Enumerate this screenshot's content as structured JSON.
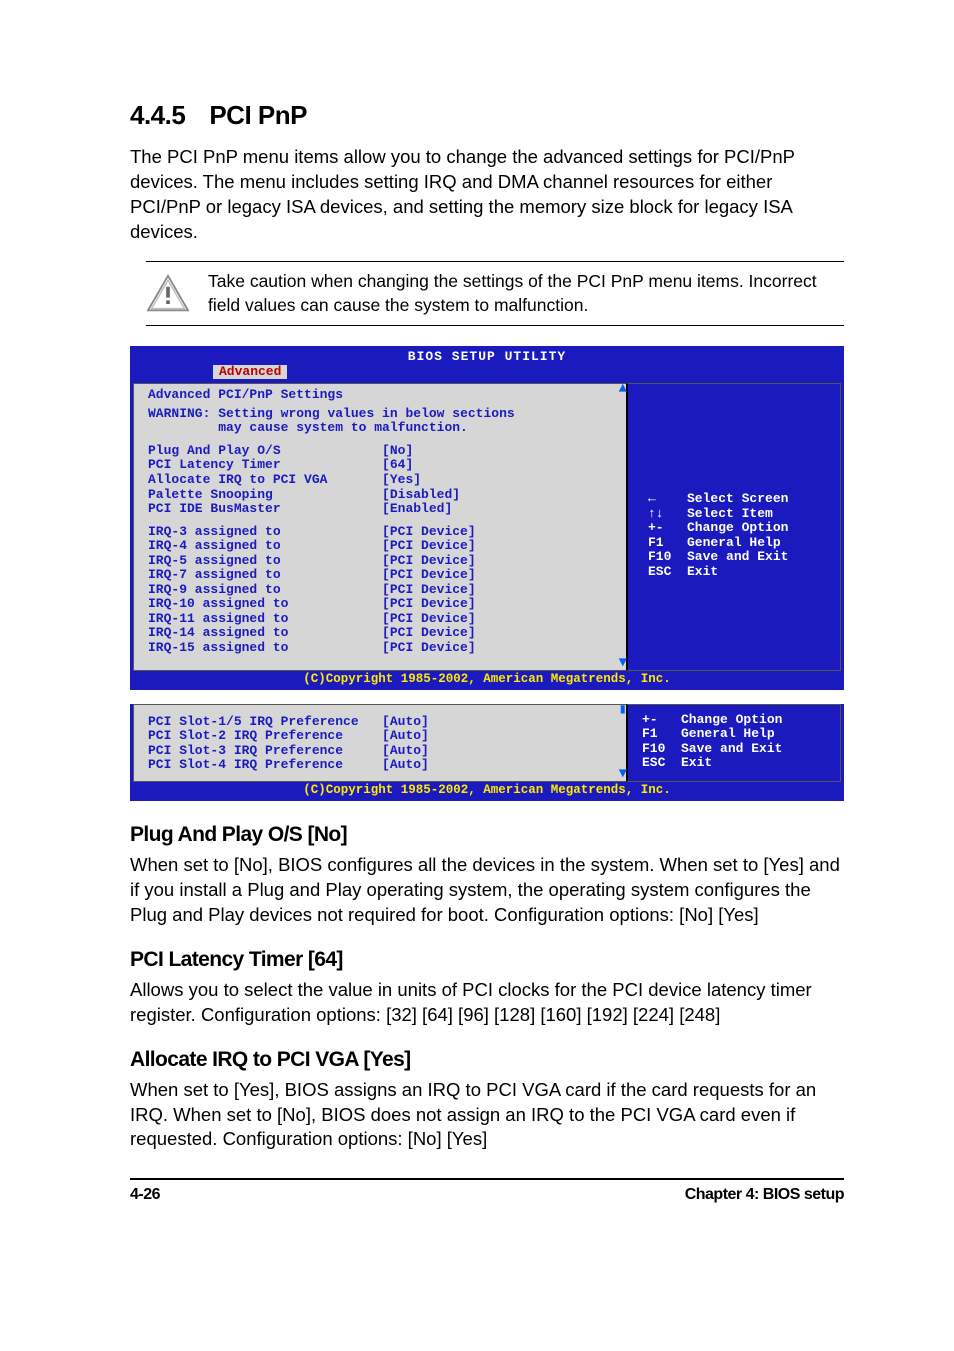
{
  "heading": {
    "num": "4.4.5",
    "title": "PCI PnP"
  },
  "intro": "The PCI PnP menu items allow you to change the advanced settings for PCI/PnP devices. The menu includes setting IRQ and DMA channel resources for either PCI/PnP or legacy ISA devices, and setting the memory size block for legacy ISA devices.",
  "caution": "Take caution when changing the settings of the PCI PnP menu items. Incorrect field values can cause the system to malfunction.",
  "bios1": {
    "title": "BIOS SETUP UTILITY",
    "tab": "Advanced",
    "subtitle": "Advanced PCI/PnP Settings",
    "warning_label": "WARNING:",
    "warning_text": "Setting wrong values in below sections\n         may cause system to malfunction.",
    "group1": [
      {
        "k": "Plug And Play O/S",
        "v": "[No]"
      },
      {
        "k": "PCI Latency Timer",
        "v": "[64]"
      },
      {
        "k": "Allocate IRQ to PCI VGA",
        "v": "[Yes]"
      },
      {
        "k": "Palette Snooping",
        "v": "[Disabled]"
      },
      {
        "k": "PCI IDE BusMaster",
        "v": "[Enabled]"
      }
    ],
    "group2": [
      {
        "k": "IRQ-3 assigned to",
        "v": "[PCI Device]"
      },
      {
        "k": "IRQ-4 assigned to",
        "v": "[PCI Device]"
      },
      {
        "k": "IRQ-5 assigned to",
        "v": "[PCI Device]"
      },
      {
        "k": "IRQ-7 assigned to",
        "v": "[PCI Device]"
      },
      {
        "k": "IRQ-9 assigned to",
        "v": "[PCI Device]"
      },
      {
        "k": "IRQ-10 assigned to",
        "v": "[PCI Device]"
      },
      {
        "k": "IRQ-11 assigned to",
        "v": "[PCI Device]"
      },
      {
        "k": "IRQ-14 assigned to",
        "v": "[PCI Device]"
      },
      {
        "k": "IRQ-15 assigned to",
        "v": "[PCI Device]"
      }
    ],
    "nav": [
      {
        "k": "←",
        "v": "Select Screen"
      },
      {
        "k": "↑↓",
        "v": "Select Item"
      },
      {
        "k": "+-",
        "v": "Change Option"
      },
      {
        "k": "F1",
        "v": "General Help"
      },
      {
        "k": "F10",
        "v": "Save and Exit"
      },
      {
        "k": "ESC",
        "v": "Exit"
      }
    ],
    "copyright": "(C)Copyright 1985-2002, American Megatrends, Inc."
  },
  "bios2": {
    "rows": [
      {
        "k": "PCI Slot-1/5 IRQ Preference",
        "v": "[Auto]"
      },
      {
        "k": "PCI Slot-2 IRQ Preference",
        "v": "[Auto]"
      },
      {
        "k": "PCI Slot-3 IRQ Preference",
        "v": "[Auto]"
      },
      {
        "k": "PCI Slot-4 IRQ Preference",
        "v": "[Auto]"
      }
    ],
    "nav": [
      {
        "k": "+-",
        "v": "Change Option"
      },
      {
        "k": "F1",
        "v": "General Help"
      },
      {
        "k": "F10",
        "v": "Save and Exit"
      },
      {
        "k": "ESC",
        "v": "Exit"
      }
    ],
    "copyright": "(C)Copyright 1985-2002, American Megatrends, Inc."
  },
  "sections": [
    {
      "h": "Plug And Play O/S [No]",
      "p": "When set to [No], BIOS configures all the devices in the system. When set to [Yes] and if you install a Plug and Play operating system, the operating system configures the Plug and Play devices not required for boot. Configuration options: [No] [Yes]"
    },
    {
      "h": "PCI Latency Timer [64]",
      "p": "Allows you to select the value in units of PCI clocks for the PCI device latency timer register. Configuration options: [32] [64] [96] [128] [160] [192] [224] [248]"
    },
    {
      "h": "Allocate IRQ to PCI VGA [Yes]",
      "p": "When set to [Yes], BIOS assigns an IRQ to PCI VGA card if the card requests for an IRQ. When set to [No], BIOS does not assign an IRQ to the PCI VGA card even if requested. Configuration options: [No] [Yes]"
    }
  ],
  "footer": {
    "left": "4-26",
    "right": "Chapter 4: BIOS setup"
  }
}
